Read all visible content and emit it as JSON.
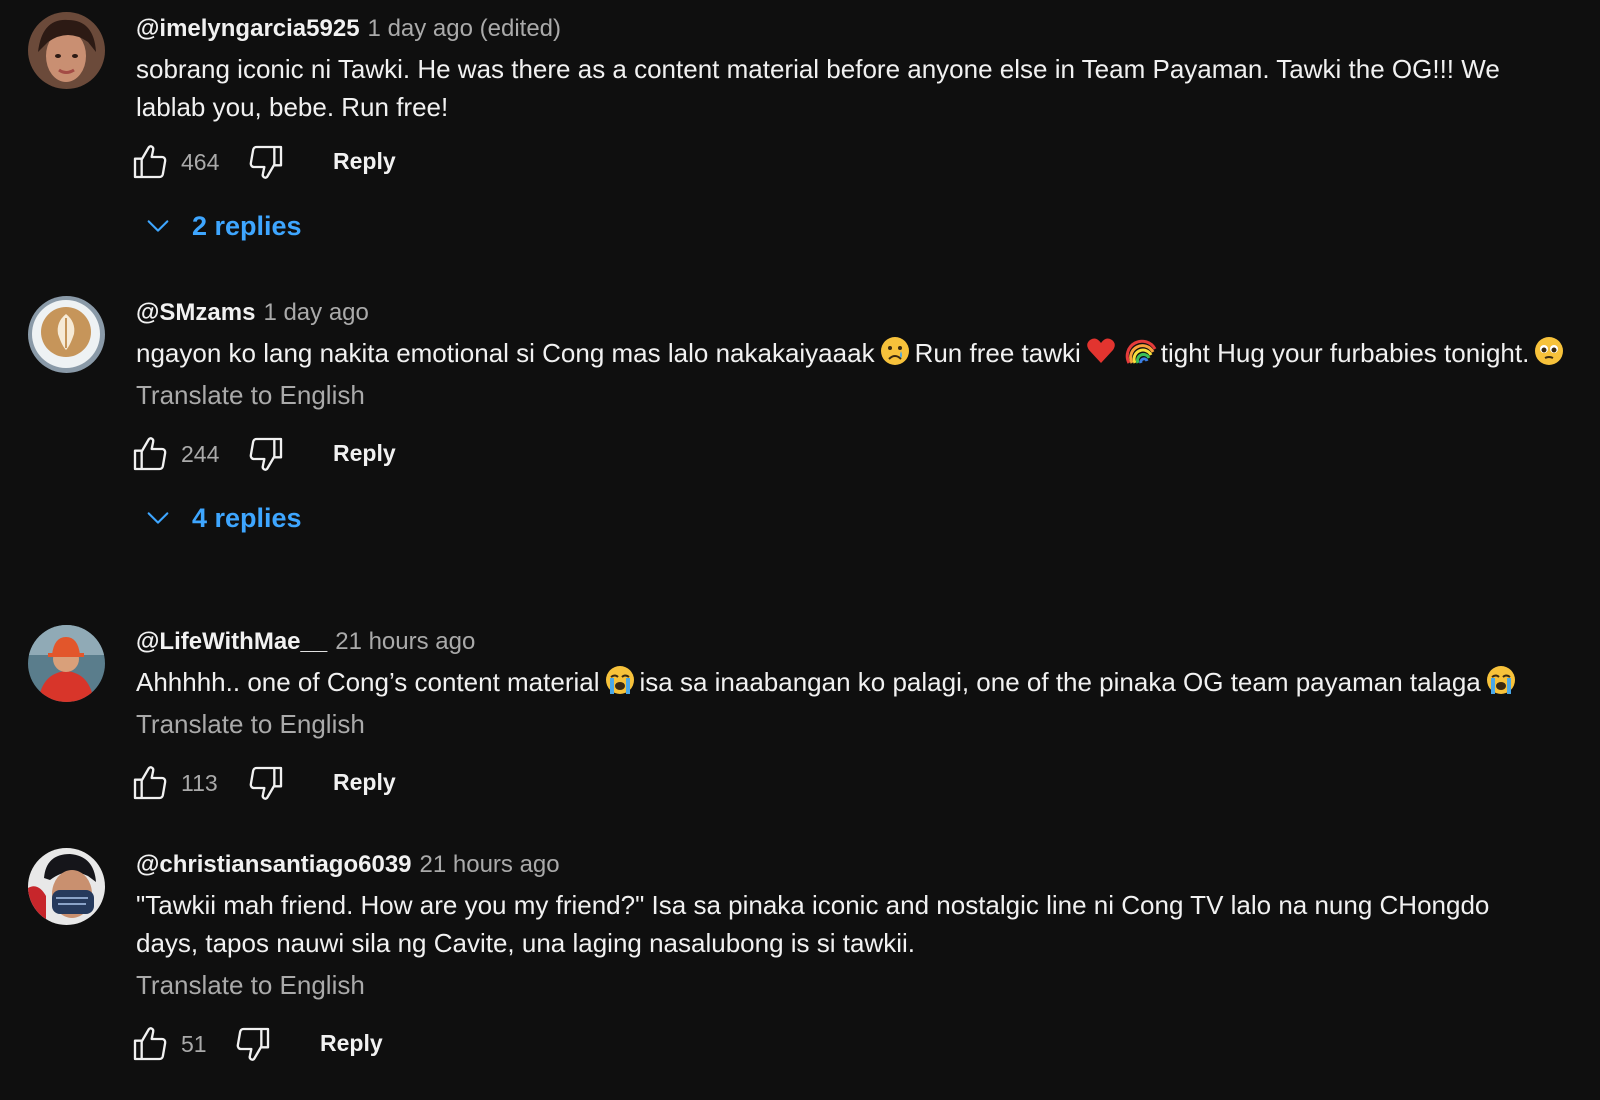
{
  "ui": {
    "translate_label": "Translate to English",
    "reply_label": "Reply"
  },
  "comments": [
    {
      "author": "@imelyngarcia5925",
      "time": "1 day ago (edited)",
      "text": "sobrang iconic ni Tawki. He was there as a content material before anyone else in Team Payaman. Tawki the OG!!! We lablab you, bebe. Run free!",
      "likes": "464",
      "replies": "2 replies"
    },
    {
      "author": "@SMzams",
      "time": "1 day ago",
      "text_parts": [
        "ngayon ko lang nakita emotional si Cong mas lalo nakakaiyaaak",
        "Run free tawki",
        "tight Hug your furbabies tonight."
      ],
      "emojis": [
        "crying-face-emoji",
        "red-heart-emoji",
        "rainbow-emoji",
        "pleading-face-emoji"
      ],
      "likes": "244",
      "replies": "4 replies"
    },
    {
      "author": "@LifeWithMae__",
      "time": "21 hours ago",
      "text_parts": [
        "Ahhhhh.. one of Cong’s content material",
        "isa sa inaabangan ko palagi, one of the pinaka OG team payaman talaga"
      ],
      "emojis": [
        "loudly-crying-face-emoji",
        "loudly-crying-face-emoji"
      ],
      "likes": "113"
    },
    {
      "author": "@christiansantiago6039",
      "time": "21 hours ago",
      "text": "\"Tawkii mah friend. How are you my friend?\" Isa sa pinaka iconic and nostalgic line ni Cong TV lalo na nung CHongdo days, tapos nauwi sila ng Cavite, una laging nasalubong is si tawkii.",
      "likes": "51"
    }
  ],
  "colors": {
    "background": "#0f0f0f",
    "text": "#f1f1f1",
    "secondary": "#aaaaaa",
    "link": "#3ea6ff"
  }
}
